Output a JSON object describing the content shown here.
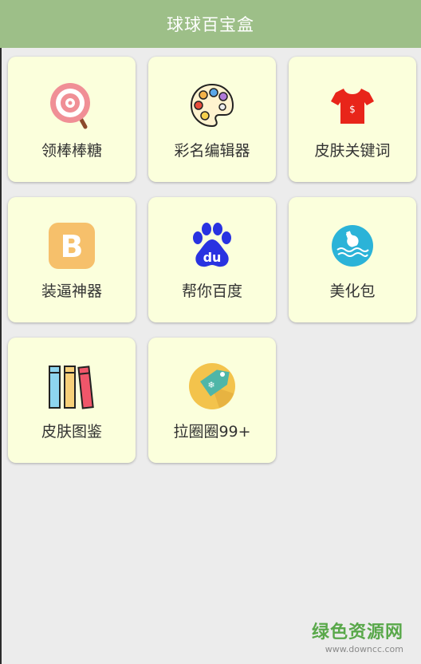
{
  "header": {
    "title": "球球百宝盒"
  },
  "cards": [
    {
      "label": "领棒棒糖",
      "icon": "lollipop-icon"
    },
    {
      "label": "彩名编辑器",
      "icon": "palette-icon"
    },
    {
      "label": "皮肤关键词",
      "icon": "tshirt-icon"
    },
    {
      "label": "装逼神器",
      "icon": "b-letter-icon"
    },
    {
      "label": "帮你百度",
      "icon": "baidu-paw-icon"
    },
    {
      "label": "美化包",
      "icon": "bottle-icon"
    },
    {
      "label": "皮肤图鉴",
      "icon": "books-icon"
    },
    {
      "label": "拉圈圈99+",
      "icon": "tag-icon"
    }
  ],
  "watermark": {
    "title": "绿色资源网",
    "url": "www.downcc.com"
  },
  "colors": {
    "header_bg": "#9dbf88",
    "card_bg": "#fbffdc",
    "page_bg": "#ececec",
    "watermark": "#59a84a"
  }
}
